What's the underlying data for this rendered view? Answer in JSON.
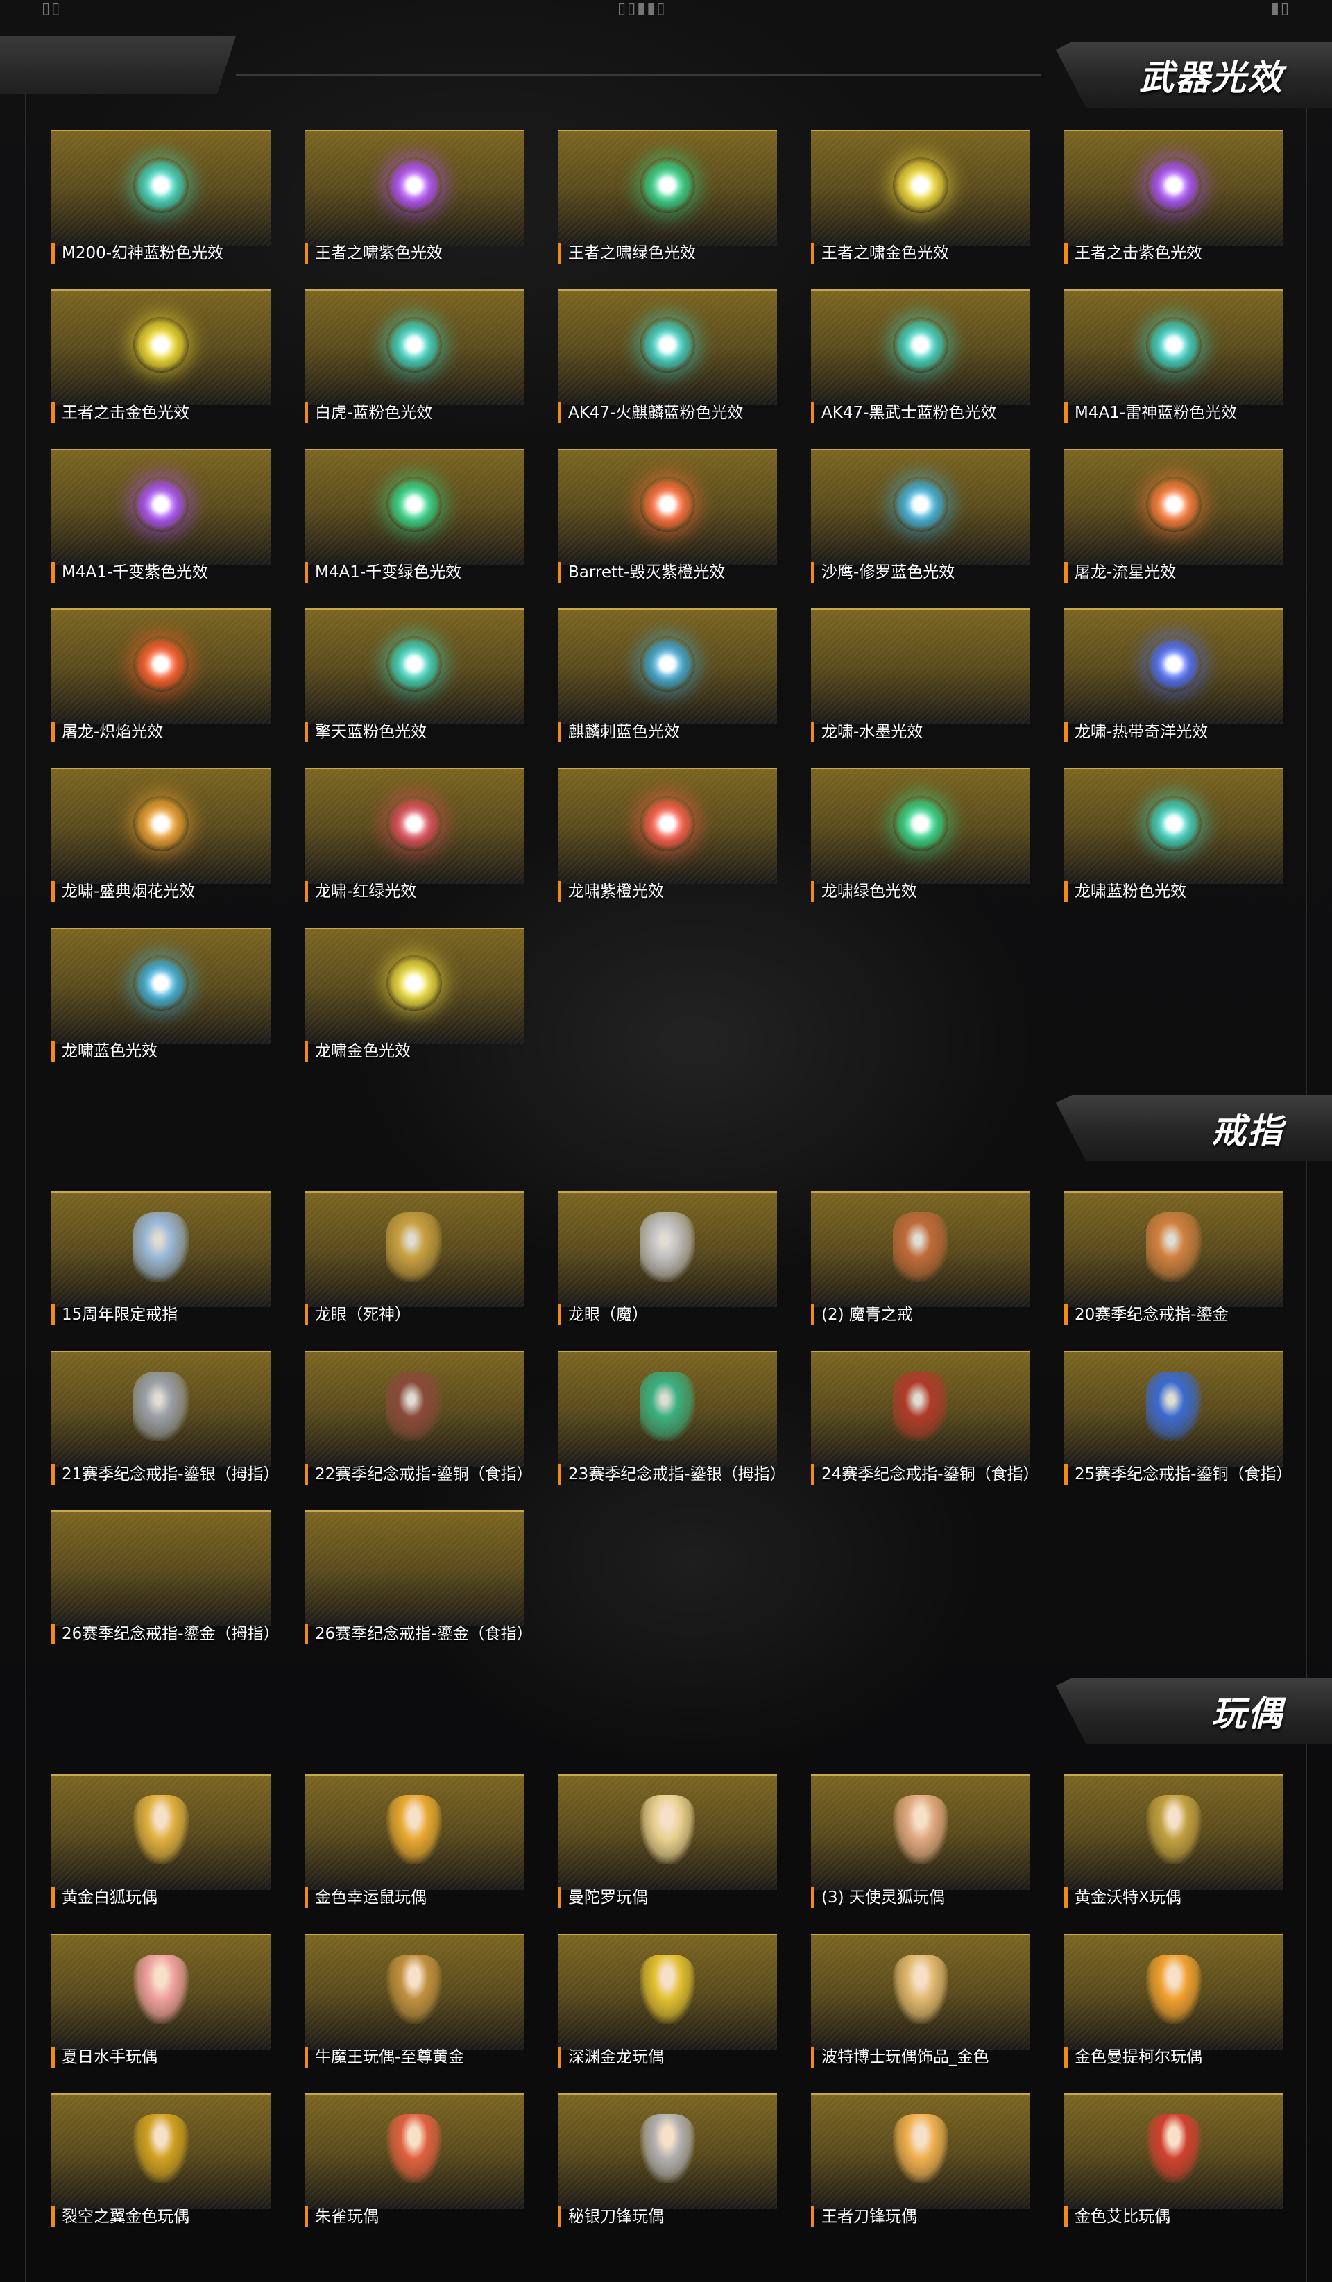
{
  "header": {
    "ticks": [
      "▯▯",
      "▯▯▮▮▯",
      "▮▯"
    ]
  },
  "sections": [
    {
      "title": "武器光效",
      "items": [
        {
          "label": "M200-幻神蓝粉色光效",
          "color": "#3bd6c2"
        },
        {
          "label": "王者之啸紫色光效",
          "color": "#b04cff"
        },
        {
          "label": "王者之啸绿色光效",
          "color": "#2fd38a"
        },
        {
          "label": "王者之啸金色光效",
          "color": "#f2dc3a"
        },
        {
          "label": "王者之击紫色光效",
          "color": "#a64dff"
        },
        {
          "label": "王者之击金色光效",
          "color": "#f0dc30"
        },
        {
          "label": "白虎-蓝粉色光效",
          "color": "#38d3c3"
        },
        {
          "label": "AK47-火麒麟蓝粉色光效",
          "color": "#3ad0c6"
        },
        {
          "label": "AK47-黑武士蓝粉色光效",
          "color": "#3ad4c4"
        },
        {
          "label": "M4A1-雷神蓝粉色光效",
          "color": "#36d2c8"
        },
        {
          "label": "M4A1-千变紫色光效",
          "color": "#a84dff"
        },
        {
          "label": "M4A1-千变绿色光效",
          "color": "#2ed88a"
        },
        {
          "label": "Barrett-毁灭紫橙光效",
          "color": "#ff6b3a"
        },
        {
          "label": "沙鹰-修罗蓝色光效",
          "color": "#3ab2e0"
        },
        {
          "label": "屠龙-流星光效",
          "color": "#ff7a3a"
        },
        {
          "label": "屠龙-炽焰光效",
          "color": "#ff5a2a"
        },
        {
          "label": "擎天蓝粉色光效",
          "color": "#38d6c0"
        },
        {
          "label": "麒麟刺蓝色光效",
          "color": "#3aa8d8"
        },
        {
          "label": "龙啸-水墨光效",
          "color": ""
        },
        {
          "label": "龙啸-热带奇洋光效",
          "color": "#4a6bff"
        },
        {
          "label": "龙啸-盛典烟花光效",
          "color": "#f0a030"
        },
        {
          "label": "龙啸-红绿光效",
          "color": "#e04a5a"
        },
        {
          "label": "龙啸紫橙光效",
          "color": "#ff5a4a"
        },
        {
          "label": "龙啸绿色光效",
          "color": "#2ed88a"
        },
        {
          "label": "龙啸蓝粉色光效",
          "color": "#38d4c4"
        },
        {
          "label": "龙啸蓝色光效",
          "color": "#3ab0e0"
        },
        {
          "label": "龙啸金色光效",
          "color": "#f0e040"
        }
      ]
    },
    {
      "title": "戒指",
      "items": [
        {
          "label": "15周年限定戒指",
          "color": "#9ab8d8"
        },
        {
          "label": "龙眼（死神）",
          "color": "#c8a040"
        },
        {
          "label": "龙眼（魔）",
          "color": "#c0c0c0"
        },
        {
          "label": "(2) 魔青之戒",
          "color": "#c06a3a"
        },
        {
          "label": "20赛季纪念戒指-鎏金",
          "color": "#d08040"
        },
        {
          "label": "21赛季纪念戒指-鎏银（拇指）",
          "color": "#9aa0a8"
        },
        {
          "label": "22赛季纪念戒指-鎏铜（食指）",
          "color": "#8a4a3a"
        },
        {
          "label": "23赛季纪念戒指-鎏银（拇指）",
          "color": "#3ab080"
        },
        {
          "label": "24赛季纪念戒指-鎏铜（食指）",
          "color": "#b03a2a"
        },
        {
          "label": "25赛季纪念戒指-鎏铜（食指）",
          "color": "#3a6ad0"
        },
        {
          "label": "26赛季纪念戒指-鎏金（拇指）",
          "color": ""
        },
        {
          "label": "26赛季纪念戒指-鎏金（食指）",
          "color": ""
        }
      ]
    },
    {
      "title": "玩偶",
      "items": [
        {
          "label": "黄金白狐玩偶",
          "color": "#e0b040"
        },
        {
          "label": "金色幸运鼠玩偶",
          "color": "#e8a830"
        },
        {
          "label": "曼陀罗玩偶",
          "color": "#e8d090"
        },
        {
          "label": "(3) 天使灵狐玩偶",
          "color": "#e0a880"
        },
        {
          "label": "黄金沃特X玩偶",
          "color": "#c0a040"
        },
        {
          "label": "夏日水手玩偶",
          "color": "#f0a0a0"
        },
        {
          "label": "牛魔王玩偶-至尊黄金",
          "color": "#c09040"
        },
        {
          "label": "深渊金龙玩偶",
          "color": "#e0c030"
        },
        {
          "label": "波特博士玩偶饰品_金色",
          "color": "#e0b870"
        },
        {
          "label": "金色曼提柯尔玩偶",
          "color": "#f0a030"
        },
        {
          "label": "裂空之翼金色玩偶",
          "color": "#d0a020"
        },
        {
          "label": "朱雀玩偶",
          "color": "#e06040"
        },
        {
          "label": "秘银刀锋玩偶",
          "color": "#b0b0b0"
        },
        {
          "label": "王者刀锋玩偶",
          "color": "#f0b050"
        },
        {
          "label": "金色艾比玩偶",
          "color": "#d04030"
        }
      ]
    }
  ]
}
